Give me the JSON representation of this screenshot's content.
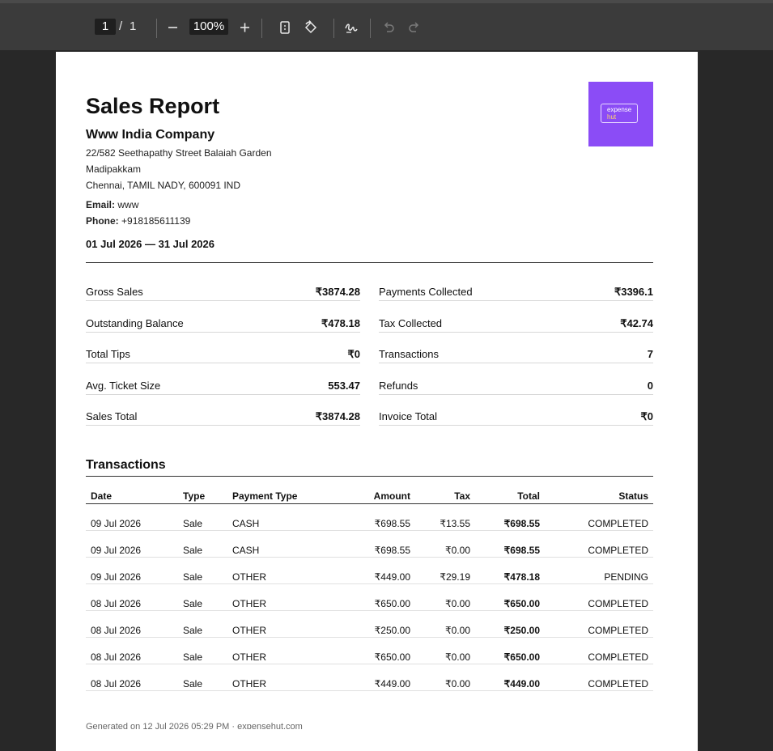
{
  "toolbar": {
    "current_page": "1",
    "page_separator": "/",
    "total_pages": "1",
    "zoom": "100%"
  },
  "report": {
    "title": "Sales Report",
    "company": "Www India Company",
    "address_lines": [
      "22/582 Seethapathy Street Balaiah Garden",
      "Madipakkam",
      "Chennai, TAMIL NADY, 600091 IND"
    ],
    "email_label": "Email:",
    "email": "www",
    "phone_label": "Phone:",
    "phone": "+918185611139",
    "period": "01 Jul 2026 — 31 Jul 2026",
    "logo_line1": "expense",
    "logo_line2": "hut"
  },
  "stats": [
    {
      "label": "Gross Sales",
      "value": "₹3874.28"
    },
    {
      "label": "Payments Collected",
      "value": "₹3396.1"
    },
    {
      "label": "Outstanding Balance",
      "value": "₹478.18"
    },
    {
      "label": "Tax Collected",
      "value": "₹42.74"
    },
    {
      "label": "Total Tips",
      "value": "₹0"
    },
    {
      "label": "Transactions",
      "value": "7"
    },
    {
      "label": "Avg. Ticket Size",
      "value": "553.47"
    },
    {
      "label": "Refunds",
      "value": "0"
    },
    {
      "label": "Sales Total",
      "value": "₹3874.28"
    },
    {
      "label": "Invoice Total",
      "value": "₹0"
    }
  ],
  "transactions": {
    "title": "Transactions",
    "headers": [
      "Date",
      "Type",
      "Payment Type",
      "Amount",
      "Tax",
      "Total",
      "Status"
    ],
    "rows": [
      [
        "09 Jul 2026",
        "Sale",
        "CASH",
        "₹698.55",
        "₹13.55",
        "₹698.55",
        "COMPLETED"
      ],
      [
        "09 Jul 2026",
        "Sale",
        "CASH",
        "₹698.55",
        "₹0.00",
        "₹698.55",
        "COMPLETED"
      ],
      [
        "09 Jul 2026",
        "Sale",
        "OTHER",
        "₹449.00",
        "₹29.19",
        "₹478.18",
        "PENDING"
      ],
      [
        "08 Jul 2026",
        "Sale",
        "OTHER",
        "₹650.00",
        "₹0.00",
        "₹650.00",
        "COMPLETED"
      ],
      [
        "08 Jul 2026",
        "Sale",
        "OTHER",
        "₹250.00",
        "₹0.00",
        "₹250.00",
        "COMPLETED"
      ],
      [
        "08 Jul 2026",
        "Sale",
        "OTHER",
        "₹650.00",
        "₹0.00",
        "₹650.00",
        "COMPLETED"
      ],
      [
        "08 Jul 2026",
        "Sale",
        "OTHER",
        "₹449.00",
        "₹0.00",
        "₹449.00",
        "COMPLETED"
      ]
    ]
  },
  "footer": "Generated on 12 Jul 2026 05:29 PM · expensehut.com"
}
